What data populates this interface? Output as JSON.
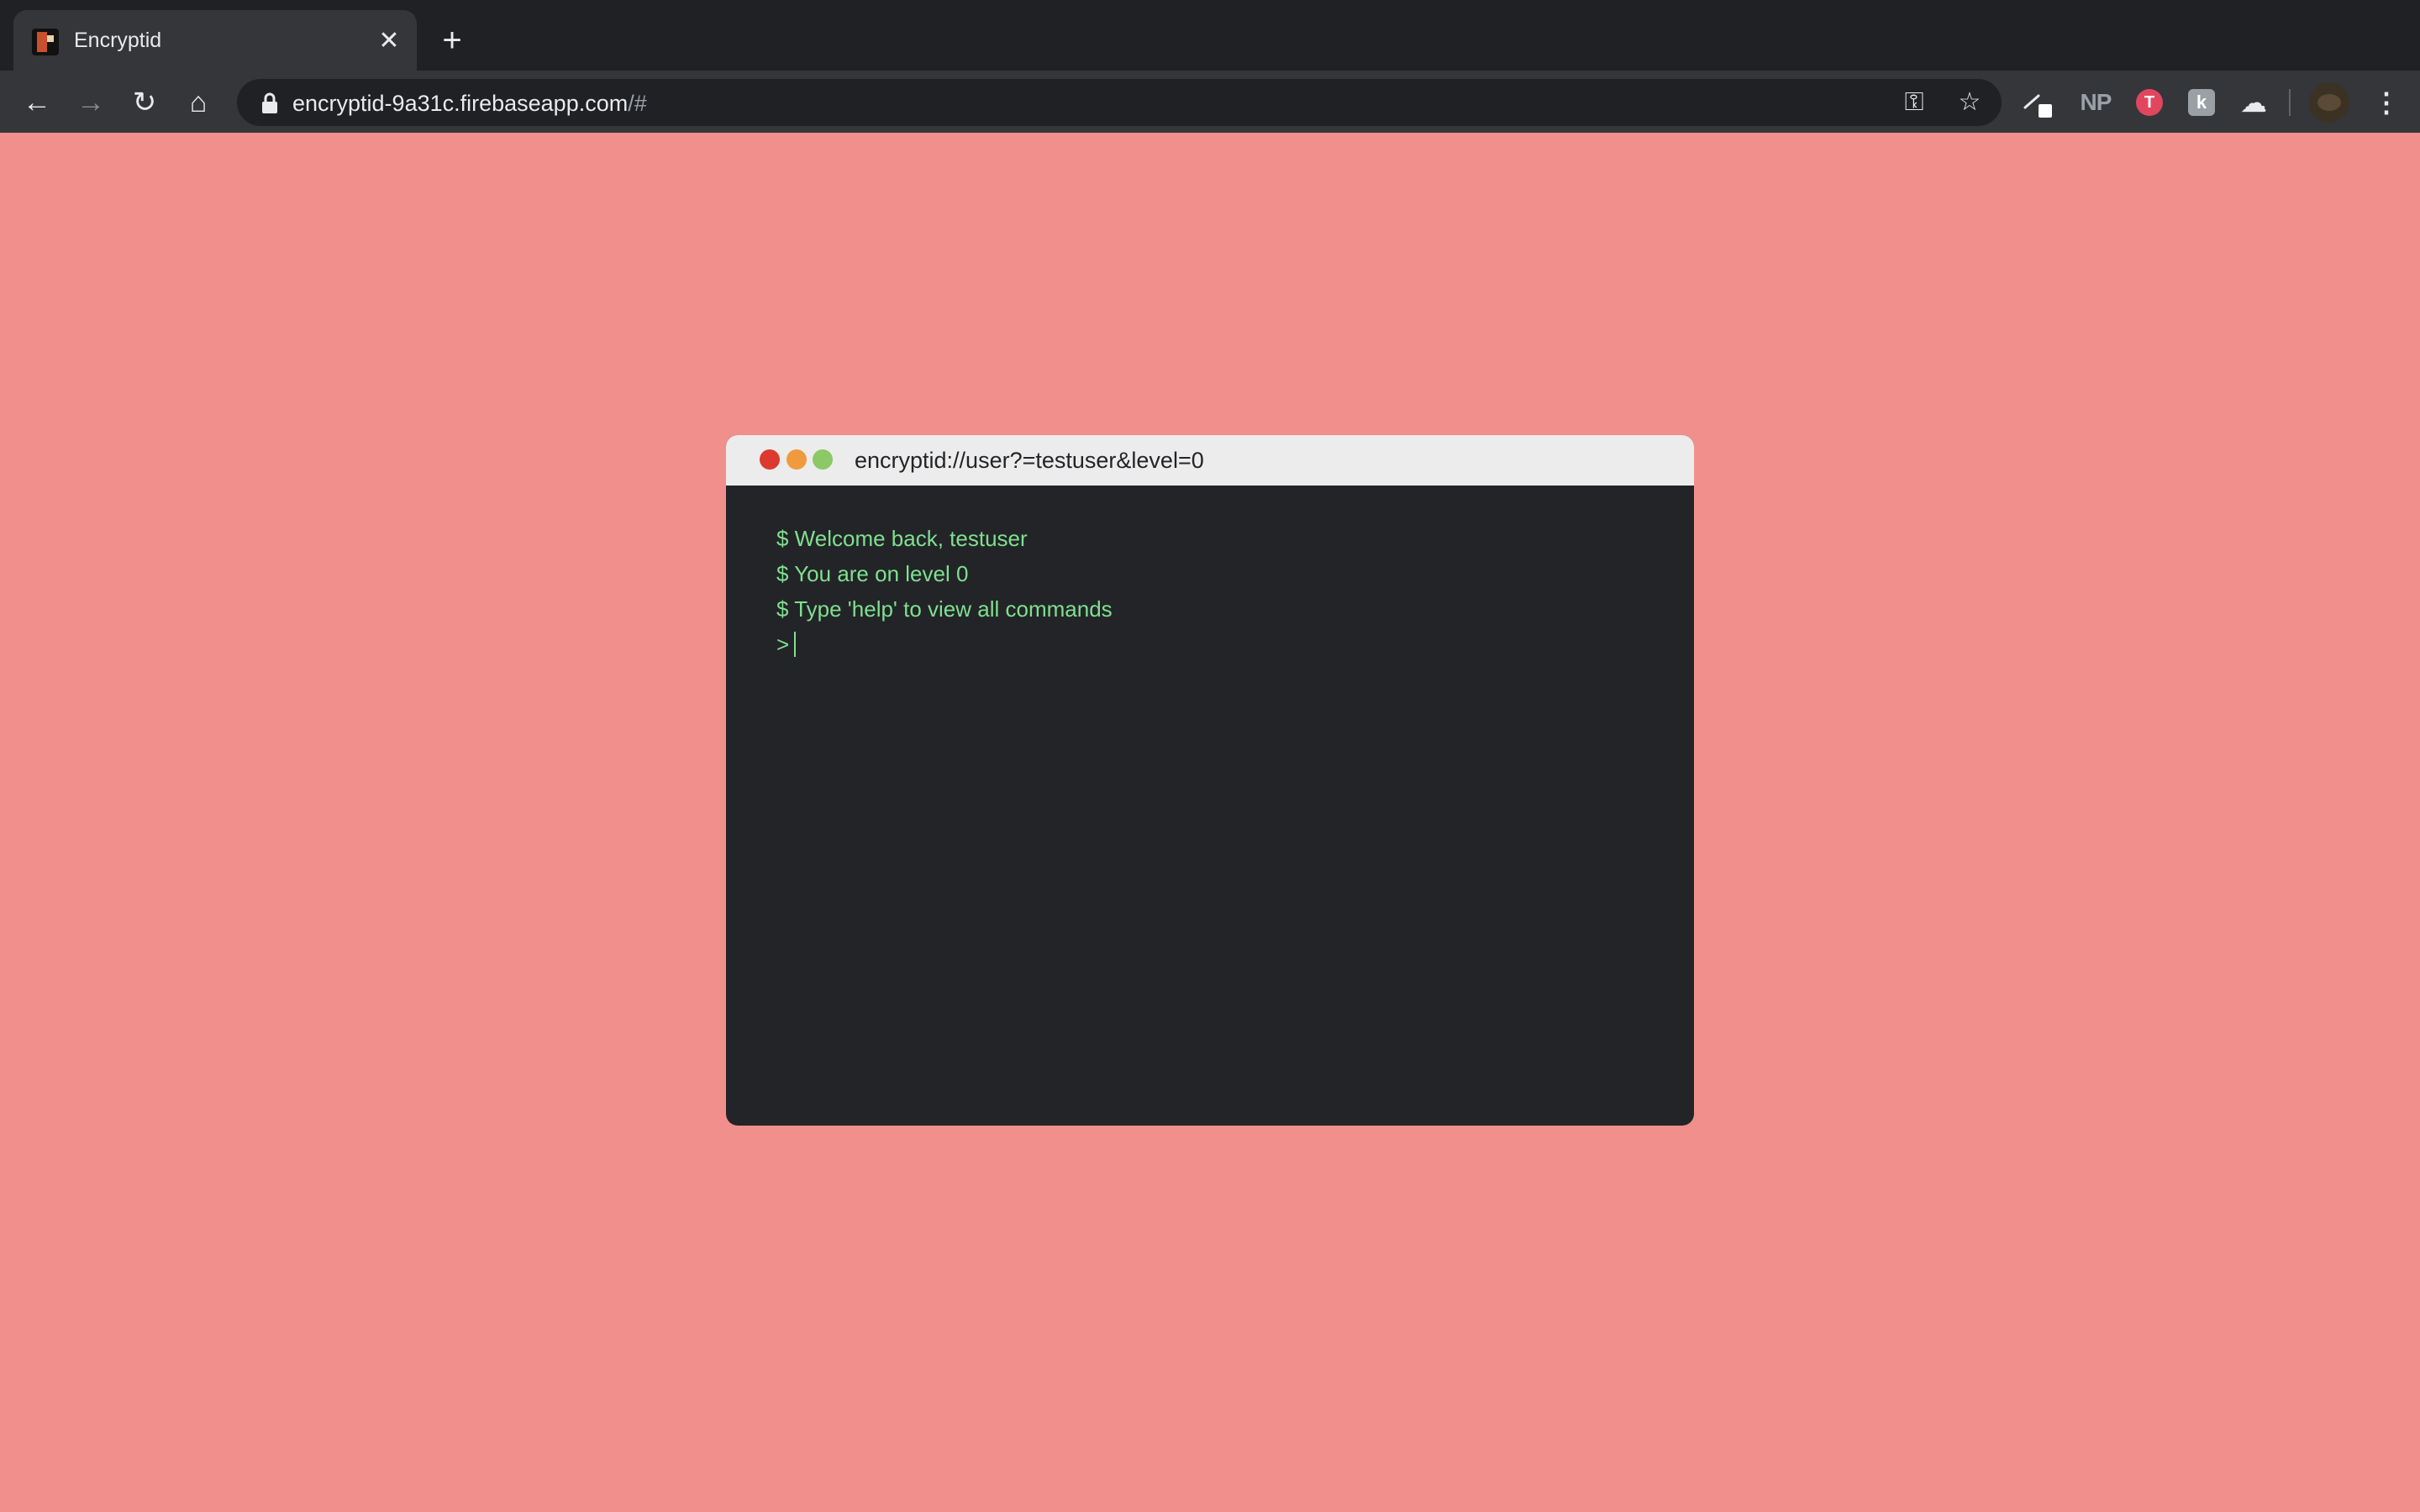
{
  "browser": {
    "tab": {
      "title": "Encryptid",
      "close_glyph": "✕"
    },
    "new_tab_glyph": "+",
    "nav": {
      "back_glyph": "←",
      "forward_glyph": "→",
      "reload_glyph": "↻",
      "home_glyph": "⌂"
    },
    "url": {
      "host": "encryptid-9a31c.firebaseapp.com",
      "path": "/#"
    },
    "omnibox_icons": {
      "key_glyph": "⚿",
      "star_glyph": "☆"
    },
    "extensions": {
      "np_label": "NP",
      "red_ext_glyph": "T",
      "gray_ext_glyph": "k",
      "cloud_glyph": "☁"
    },
    "menu_glyph": "⋮"
  },
  "terminal": {
    "title": "encryptid://user?=testuser&level=0",
    "lines": [
      "$ Welcome back, testuser",
      "$ You are on level 0",
      "$ Type 'help' to view all commands"
    ],
    "prompt": ">"
  },
  "colors": {
    "page_background": "#f08f8c",
    "terminal_background": "#232428",
    "terminal_text": "#7fe08e",
    "titlebar": "#ececec"
  }
}
